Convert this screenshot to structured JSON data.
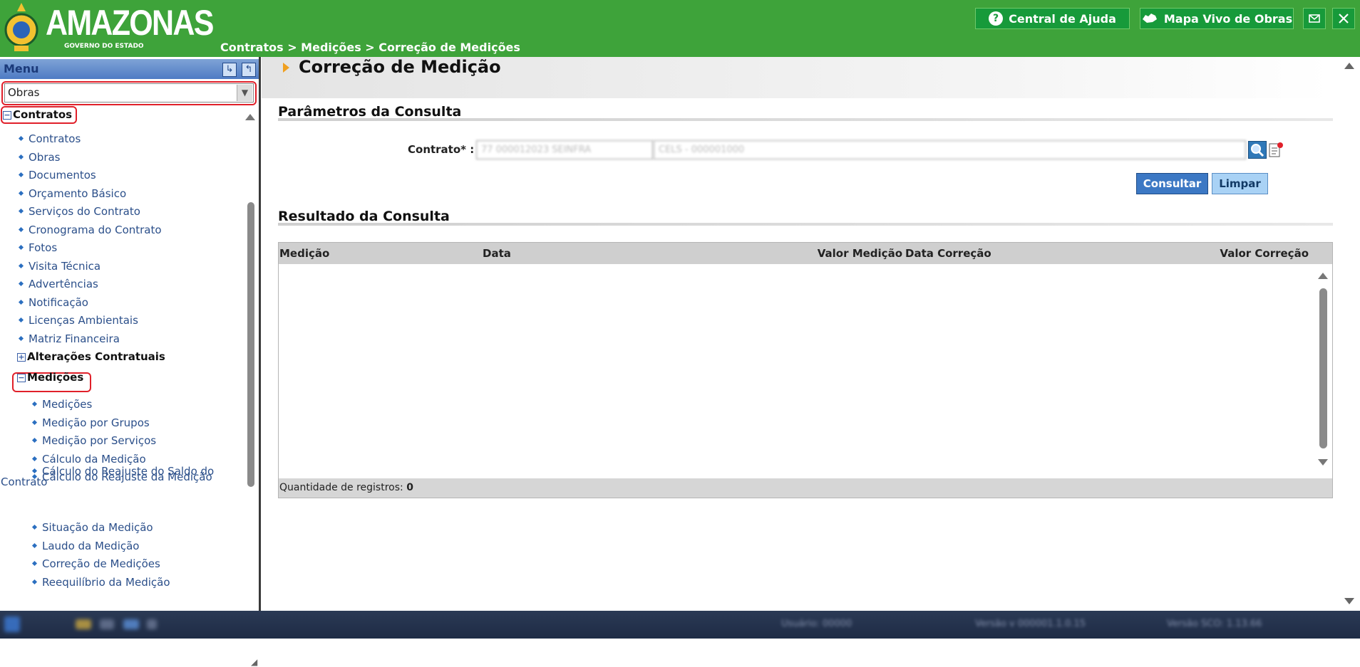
{
  "colors": {
    "header_bg": "#3ea33a",
    "header_btn": "#179a3a",
    "link": "#2b4f8a",
    "highlight": "#e0202a",
    "consultar_bg": "#3c78c4",
    "limpar_bg": "#a9d2f5"
  },
  "header": {
    "logo_title": "AMAZONAS",
    "logo_subtitle": "GOVERNO DO ESTADO",
    "breadcrumb": "Contratos > Medições > Correção de Medições",
    "help_button": "Central de Ajuda",
    "map_button": "Mapa Vivo de Obras",
    "mail_icon": "envelope-icon",
    "close_icon": "close-icon"
  },
  "sidebar": {
    "title": "Menu",
    "module_select": "Obras",
    "contratos_group": "Contratos",
    "contratos_items": [
      "Contratos",
      "Obras",
      "Documentos",
      "Orçamento Básico",
      "Serviços do Contrato",
      "Cronograma do Contrato",
      "Fotos",
      "Visita Técnica",
      "Advertências",
      "Notificação",
      "Licenças Ambientais",
      "Matriz Financeira"
    ],
    "alteracoes_group": "Alterações Contratuais",
    "medicoes_group": "Medições",
    "medicoes_items": [
      "Medições",
      "Medição por Grupos",
      "Medição por Serviços",
      "Cálculo da Medição",
      "Cálculo do Reajuste da Medição"
    ],
    "reajuste_saldo_line1": "Cálculo do Reajuste do Saldo do",
    "reajuste_saldo_line2": "Contrato",
    "medicoes_items_after": [
      "Situação da Medição",
      "Laudo da Medição",
      "Correção de Medições",
      "Reequilíbrio da Medição"
    ]
  },
  "main": {
    "page_title": "Correção de Medição",
    "params_title": "Parâmetros da Consulta",
    "contrato_label": "Contrato* :",
    "contrato_code": "77 000012023 SEINFRA",
    "contrato_name": "CELS - 000001000",
    "consultar_button": "Consultar",
    "limpar_button": "Limpar",
    "result_title": "Resultado da Consulta",
    "columns": [
      "Medição",
      "Data",
      "Valor Medição",
      "Data Correção",
      "Valor Correção"
    ],
    "records_label": "Quantidade de registros:",
    "records_count": "0"
  },
  "taskbar": {
    "user": "Usuário: 00000",
    "version_a": "Versão v 000001.1.0.15",
    "version_b": "Versão SCO: 1.13.66"
  }
}
